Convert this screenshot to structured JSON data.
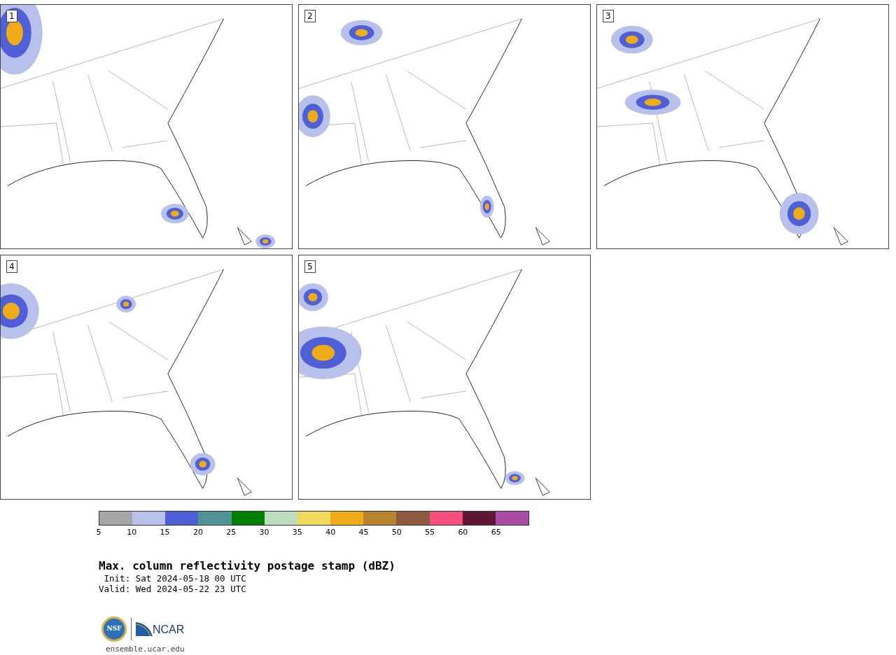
{
  "panels": [
    {
      "label": "1"
    },
    {
      "label": "2"
    },
    {
      "label": "3"
    },
    {
      "label": "4"
    },
    {
      "label": "5"
    }
  ],
  "colorbar": {
    "bins": [
      {
        "color": "#a6a6a6"
      },
      {
        "color": "#b7c1ec"
      },
      {
        "color": "#4f5fd6"
      },
      {
        "color": "#4f9396"
      },
      {
        "color": "#008000"
      },
      {
        "color": "#bfdcbf"
      },
      {
        "color": "#f0da5e"
      },
      {
        "color": "#eeac18"
      },
      {
        "color": "#b9832f"
      },
      {
        "color": "#8b5a3f"
      },
      {
        "color": "#f5507c"
      },
      {
        "color": "#601735"
      },
      {
        "color": "#ac4ba6"
      }
    ],
    "ticks": [
      "5",
      "10",
      "15",
      "20",
      "25",
      "30",
      "35",
      "40",
      "45",
      "50",
      "55",
      "60",
      "65"
    ]
  },
  "title": "Max. column reflectivity postage stamp (dBZ)",
  "init": " Init: Sat 2024-05-18 00 UTC",
  "valid": "Valid: Wed 2024-05-22 23 UTC",
  "logo": {
    "left": "NSF",
    "right": "NCAR"
  },
  "footer": "ensemble.ucar.edu"
}
